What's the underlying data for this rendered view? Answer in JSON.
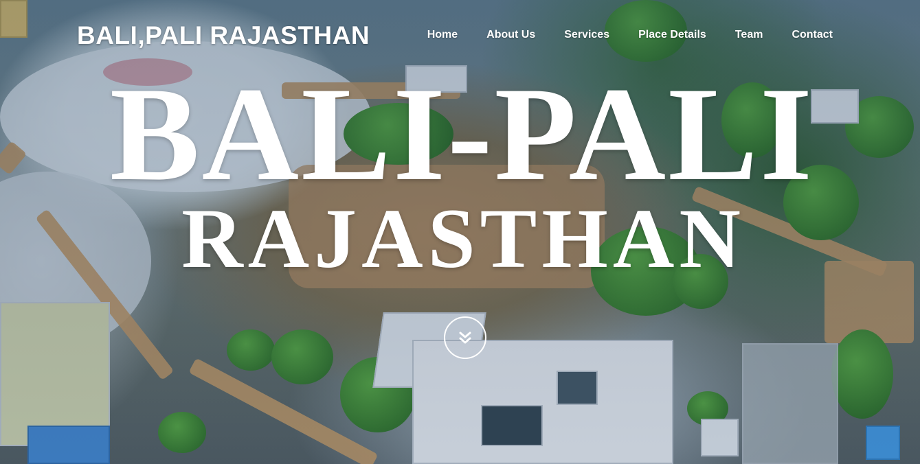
{
  "header": {
    "brand": "BALI,PALI RAJASTHAN"
  },
  "nav": {
    "items": [
      {
        "label": "Home"
      },
      {
        "label": "About Us"
      },
      {
        "label": "Services"
      },
      {
        "label": "Place Details"
      },
      {
        "label": "Team"
      },
      {
        "label": "Contact"
      }
    ]
  },
  "hero": {
    "title_line1": "BALI-PALI",
    "title_line2": "RAJASTHAN",
    "scroll_icon": "chevron-double-down-icon",
    "background": "aerial-fort-photo"
  },
  "colors": {
    "text": "#ffffff",
    "overlay": "#1e3c5a"
  }
}
